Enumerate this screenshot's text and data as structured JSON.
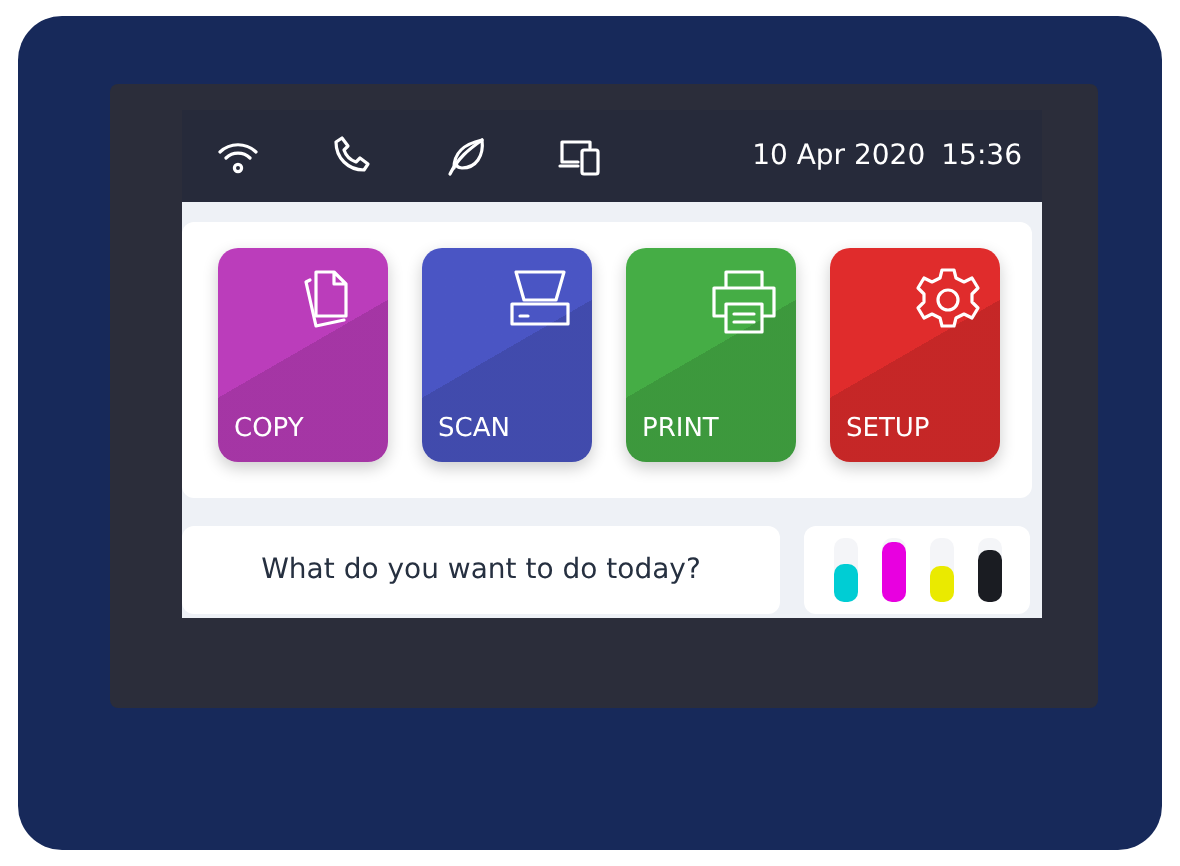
{
  "status_bar": {
    "date": "10 Apr 2020",
    "time": "15:36"
  },
  "tiles": [
    {
      "label": "COPY",
      "kind": "copy",
      "color": "#bb3dbb"
    },
    {
      "label": "SCAN",
      "kind": "scan",
      "color": "#4a55c4"
    },
    {
      "label": "PRINT",
      "kind": "print",
      "color": "#45ad45"
    },
    {
      "label": "SETUP",
      "kind": "setup",
      "color": "#e02c2c"
    }
  ],
  "message": "What do you want to do today?",
  "inks": [
    {
      "color": "#00cdd4",
      "level": 0.6
    },
    {
      "color": "#e800e0",
      "level": 0.95
    },
    {
      "color": "#eaea00",
      "level": 0.55
    },
    {
      "color": "#1a1c22",
      "level": 0.8
    }
  ]
}
